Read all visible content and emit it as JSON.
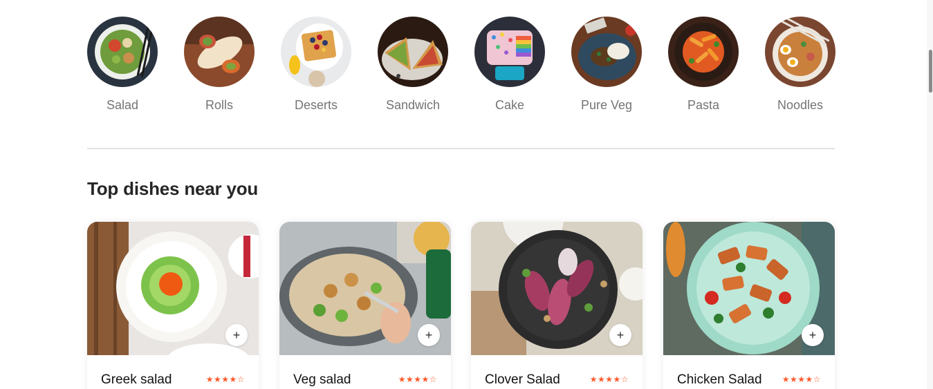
{
  "categories": [
    {
      "label": "Salad",
      "icon": "salad-image"
    },
    {
      "label": "Rolls",
      "icon": "rolls-image"
    },
    {
      "label": "Deserts",
      "icon": "deserts-image"
    },
    {
      "label": "Sandwich",
      "icon": "sandwich-image"
    },
    {
      "label": "Cake",
      "icon": "cake-image"
    },
    {
      "label": "Pure Veg",
      "icon": "pure-veg-image"
    },
    {
      "label": "Pasta",
      "icon": "pasta-image"
    },
    {
      "label": "Noodles",
      "icon": "noodles-image"
    }
  ],
  "section": {
    "title": "Top dishes near you"
  },
  "dishes": [
    {
      "name": "Greek salad",
      "rating": "★★★★☆",
      "add_label": "+"
    },
    {
      "name": "Veg salad",
      "rating": "★★★★☆",
      "add_label": "+"
    },
    {
      "name": "Clover Salad",
      "rating": "★★★★☆",
      "add_label": "+"
    },
    {
      "name": "Chicken Salad",
      "rating": "★★★★☆",
      "add_label": "+"
    }
  ],
  "colors": {
    "rating": "#ff5a2b",
    "label": "#747474",
    "title": "#262626",
    "divider": "#e2e2e2"
  }
}
